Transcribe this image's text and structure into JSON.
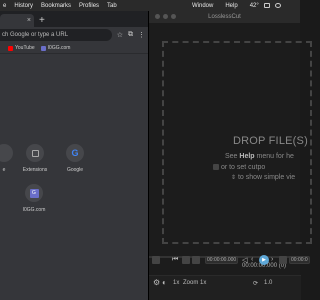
{
  "menubar": {
    "items": [
      "e",
      "History",
      "Bookmarks",
      "Profiles",
      "Tab"
    ],
    "right_items": [
      "Window",
      "Help"
    ],
    "status": "42°"
  },
  "chrome": {
    "tab_close": "×",
    "new_tab": "+",
    "omnibox_placeholder": "ch Google or type a URL",
    "star": "☆",
    "extensions": "⧉",
    "bookmarks": [
      {
        "label": "YouTube",
        "color": "#ff0000"
      },
      {
        "label": "I0GG.com",
        "color": "#6a6ec8"
      }
    ],
    "shortcuts": [
      {
        "label": "e"
      },
      {
        "label": "Extensions"
      },
      {
        "label": "Google",
        "glyph": "G"
      },
      {
        "label": "I0GG.com",
        "glyph": "G"
      }
    ]
  },
  "losslesscut": {
    "title": "LosslessCut",
    "drop_title": "DROP FILE(S)",
    "help_line_prefix": "See ",
    "help_line_bold": "Help",
    "help_line_suffix": " menu for he",
    "cutpoint_line": " or  to set cutpo",
    "simple_view_line": " to show simple vie",
    "timecode": "00:00:00.000 (0)",
    "controls": {
      "rate": "1x",
      "zoom": "Zoom 1x",
      "start_time": "00:00:00.000",
      "end_time": "00:00:0",
      "speed": "1.0"
    }
  }
}
